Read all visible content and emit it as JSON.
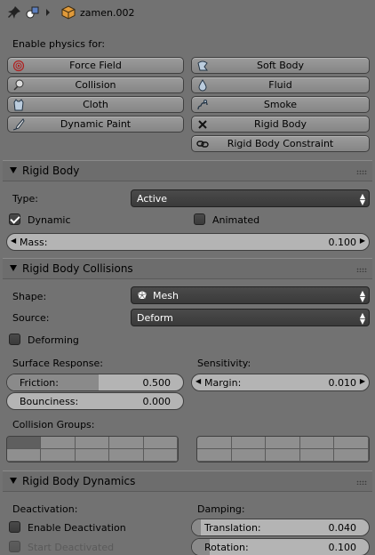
{
  "header": {
    "object_name": "zamen.002",
    "icons": [
      "pin-icon",
      "scene-icon",
      "arrow-icon",
      "cube-icon"
    ]
  },
  "physics": {
    "enable_label": "Enable physics for:",
    "buttons_left": [
      {
        "label": "Force Field",
        "icon": "force-field-icon"
      },
      {
        "label": "Collision",
        "icon": "collision-icon"
      },
      {
        "label": "Cloth",
        "icon": "cloth-icon"
      },
      {
        "label": "Dynamic Paint",
        "icon": "dynamic-paint-icon"
      }
    ],
    "buttons_right": [
      {
        "label": "Soft Body",
        "icon": "soft-body-icon"
      },
      {
        "label": "Fluid",
        "icon": "fluid-icon"
      },
      {
        "label": "Smoke",
        "icon": "smoke-icon"
      },
      {
        "label": "Rigid Body",
        "icon": "close-icon"
      },
      {
        "label": "Rigid Body Constraint",
        "icon": "link-icon"
      }
    ]
  },
  "rigid_body": {
    "title": "Rigid Body",
    "type_label": "Type:",
    "type_value": "Active",
    "dynamic_label": "Dynamic",
    "dynamic_checked": true,
    "animated_label": "Animated",
    "animated_checked": false,
    "mass_label": "Mass:",
    "mass_value": "0.100"
  },
  "collisions": {
    "title": "Rigid Body Collisions",
    "shape_label": "Shape:",
    "shape_value": "Mesh",
    "source_label": "Source:",
    "source_value": "Deform",
    "deforming_label": "Deforming",
    "surface_label": "Surface Response:",
    "sensitivity_label": "Sensitivity:",
    "friction_label": "Friction:",
    "friction_value": "0.500",
    "friction_fraction": 0.5,
    "bounciness_label": "Bounciness:",
    "bounciness_value": "0.000",
    "margin_label": "Margin:",
    "margin_value": "0.010",
    "groups_label": "Collision Groups:"
  },
  "dynamics": {
    "title": "Rigid Body Dynamics",
    "deactivation_label": "Deactivation:",
    "damping_label": "Damping:",
    "enable_deactivation_label": "Enable Deactivation",
    "start_deactivated_label": "Start Deactivated",
    "translation_label": "Translation:",
    "translation_value": "0.040",
    "rotation_label": "Rotation:",
    "rotation_value": "0.100"
  }
}
